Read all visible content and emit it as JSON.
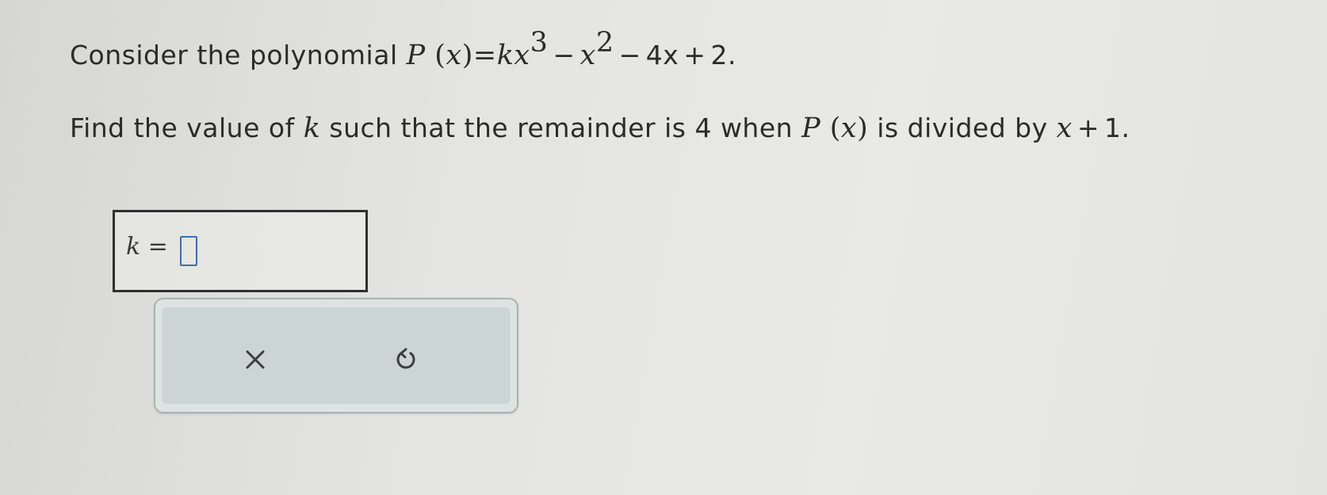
{
  "question": {
    "line1": {
      "prefix": "Consider the polynomial ",
      "P": "P",
      "open": " (",
      "x": "x",
      "close_eq": ")=",
      "k": "k",
      "x3": "x",
      "exp3": "3",
      "minus1": "−",
      "x2": "x",
      "exp2": "2",
      "minus2": "−",
      "term4x": "4x",
      "plus": "+",
      "const": "2."
    },
    "line2": {
      "prefix": "Find the value of ",
      "k": "k",
      "middle": " such that the remainder is 4 when ",
      "P": "P",
      "open": " (",
      "x": "x",
      "close": ")",
      "suffix": " is divided by ",
      "x_div": "x",
      "plus": "+",
      "one": "1."
    }
  },
  "answer": {
    "variable": "k",
    "equals": " =",
    "value": ""
  },
  "toolbar": {
    "clear_icon": "x-icon",
    "reset_icon": "undo-icon"
  },
  "colors": {
    "input_border": "#3b6fb0",
    "toolbar_bg": "#cbd5d4"
  }
}
